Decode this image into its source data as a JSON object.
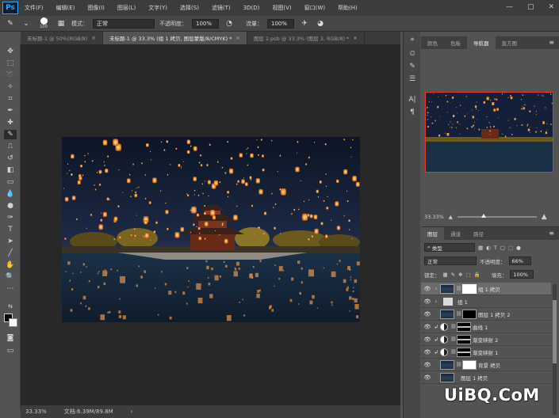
{
  "menu": {
    "items": [
      "文件(F)",
      "编辑(E)",
      "图像(I)",
      "图层(L)",
      "文字(Y)",
      "选择(S)",
      "滤镜(T)",
      "3D(D)",
      "视图(V)",
      "窗口(W)",
      "帮助(H)"
    ],
    "logo": "Ps"
  },
  "options": {
    "brush_size": "100",
    "mode_label": "模式：",
    "mode_value": "正常",
    "opacity_label": "不透明度：",
    "opacity_value": "100%",
    "flow_label": "流量：",
    "flow_value": "100%"
  },
  "tabs": [
    {
      "label": "未标题-1 @ 50%(RGB/8)",
      "active": false
    },
    {
      "label": "未标题-1 @ 33.3% (组 1 拷贝, 图层蒙版/8/CMYK) *",
      "active": true
    },
    {
      "label": "图层 2.psb @ 33.3% (图层 3, RGB/8) *",
      "active": false
    }
  ],
  "status": {
    "zoom": "33.33%",
    "doc_info": "文档:6.39M/89.8M"
  },
  "nav_panel": {
    "tabs": [
      "颜色",
      "色板",
      "导航器",
      "直方图"
    ],
    "active_tab": "导航器",
    "zoom": "33.33%"
  },
  "layers_panel": {
    "tabs": [
      "图层",
      "通道",
      "路径"
    ],
    "active_tab": "图层",
    "filter_kind": "类型",
    "blend_mode": "正常",
    "opacity_label": "不透明度：",
    "opacity_value": "66%",
    "lock_label": "锁定：",
    "fill_label": "填充：",
    "fill_value": "100%",
    "layers": [
      {
        "name": "组 1 拷贝",
        "type": "group-copy",
        "selected": true,
        "clipped": false
      },
      {
        "name": "组 1",
        "type": "folder",
        "selected": false,
        "clipped": false
      },
      {
        "name": "图层 1 拷贝 2",
        "type": "pixel",
        "selected": false,
        "clipped": false
      },
      {
        "name": "曲线 1",
        "type": "adjustment",
        "selected": false,
        "clipped": true
      },
      {
        "name": "渐变映射 2",
        "type": "adjustment",
        "selected": false,
        "clipped": true
      },
      {
        "name": "渐变映射 1",
        "type": "adjustment",
        "selected": false,
        "clipped": true
      },
      {
        "name": "背景 拷贝",
        "type": "pixel-white",
        "selected": false,
        "clipped": false
      },
      {
        "name": "图层 1 拷贝",
        "type": "pixel-plain",
        "selected": false,
        "clipped": false
      }
    ]
  },
  "watermark": "UiBQ.CoM",
  "colors": {
    "accent": "#31a8ff",
    "nav_frame": "#e32222",
    "workspace": "#282828"
  }
}
